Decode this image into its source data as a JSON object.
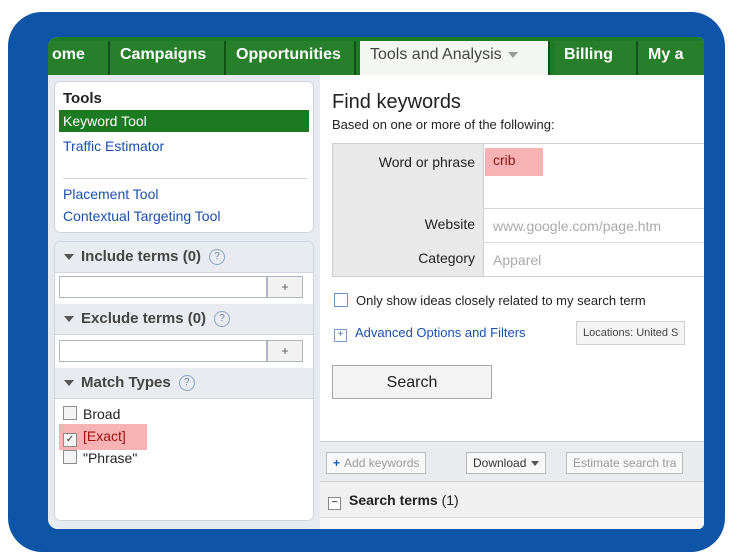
{
  "nav": {
    "tabs": [
      "ome",
      "Campaigns",
      "Opportunities",
      "Tools and Analysis",
      "Billing",
      "My a"
    ]
  },
  "sidebar": {
    "tools_title": "Tools",
    "tools": [
      "Keyword Tool",
      "Traffic Estimator",
      "Placement Tool",
      "Contextual Targeting Tool"
    ],
    "include_label": "Include terms (0)",
    "exclude_label": "Exclude terms (0)",
    "match_label": "Match Types",
    "add_button": "+",
    "help": "?",
    "match_types": [
      {
        "label": "Broad",
        "checked": false
      },
      {
        "label": "[Exact]",
        "checked": true
      },
      {
        "label": "\"Phrase\"",
        "checked": false
      }
    ]
  },
  "main": {
    "title": "Find keywords",
    "subtitle": "Based on one or more of the following:",
    "word_label": "Word or phrase",
    "word_value": "crib",
    "website_label": "Website",
    "website_placeholder": "www.google.com/page.htm",
    "category_label": "Category",
    "category_value": "Apparel",
    "only_show": "Only show ideas closely related to my search term",
    "advanced": "Advanced Options and Filters",
    "locations": "Locations: United S",
    "search_button": "Search"
  },
  "results": {
    "add_keywords": "Add keywords",
    "download": "Download",
    "estimate": "Estimate search tra",
    "search_terms_label": "Search terms",
    "search_terms_count": "(1)"
  },
  "colors": {
    "frame": "#0e55a8",
    "nav_green": "#1f7a26",
    "highlight": "#f7b3b3",
    "link": "#1a4fb1"
  }
}
